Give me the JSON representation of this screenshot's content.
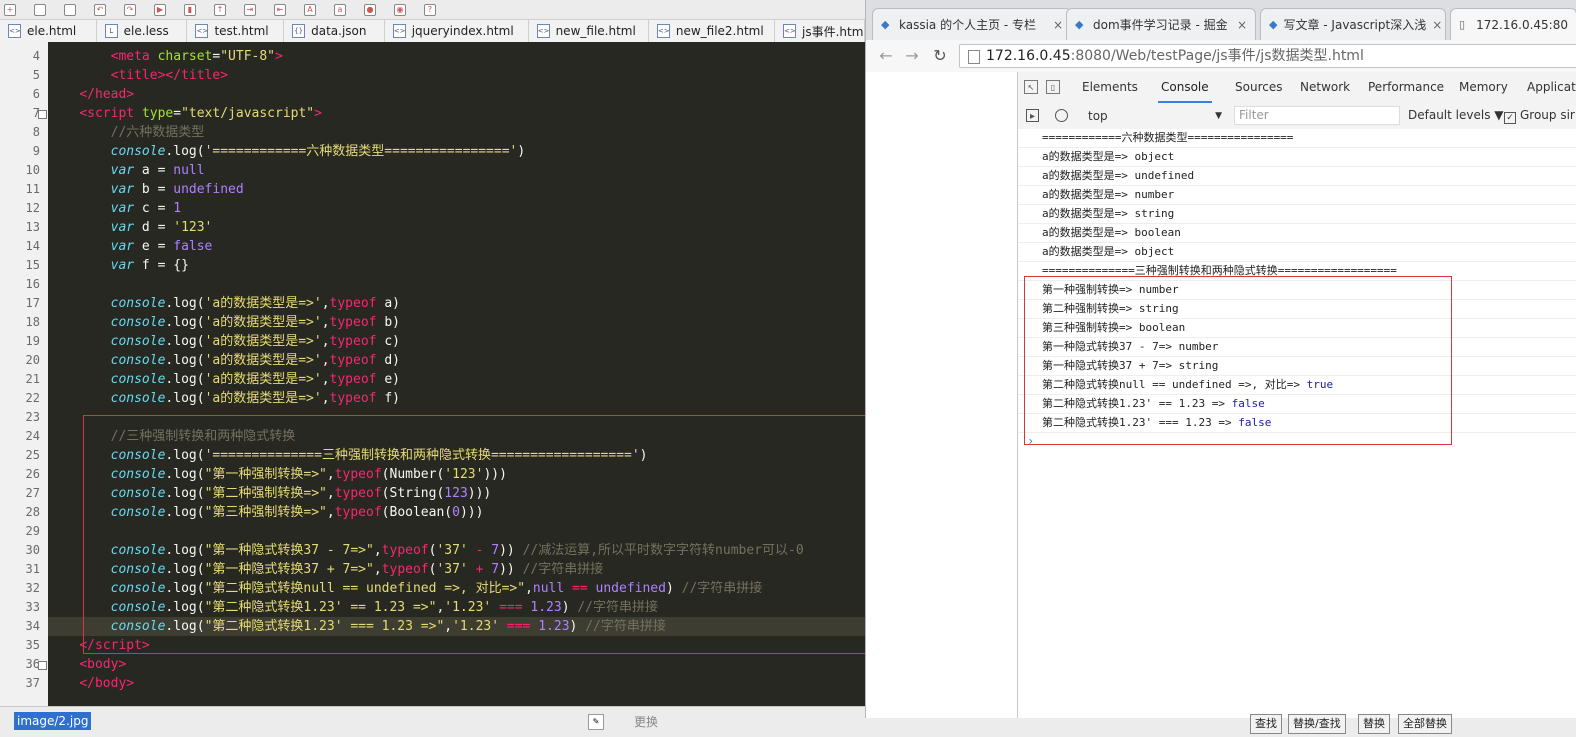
{
  "editor": {
    "tabs": [
      "ele.html",
      "ele.less",
      "test.html",
      "data.json",
      "jqueryindex.html",
      "new_file.html",
      "new_file2.html",
      "js事件.htm"
    ],
    "line_numbers": [
      "4",
      "5",
      "6",
      "7",
      "8",
      "9",
      "10",
      "11",
      "12",
      "13",
      "14",
      "15",
      "16",
      "17",
      "18",
      "19",
      "20",
      "21",
      "22",
      "23",
      "24",
      "25",
      "26",
      "27",
      "28",
      "29",
      "30",
      "31",
      "32",
      "33",
      "34",
      "35",
      "36",
      "37"
    ],
    "status_path": "image/2.jpg",
    "replace_label": "更换"
  },
  "browser": {
    "tabs": [
      "kassia 的个人主页 - 专栏",
      "dom事件学习记录 - 掘金",
      "写文章 - Javascript深入浅",
      "172.16.0.45:80"
    ],
    "url_host": "172.16.0.45",
    "url_rest": ":8080/Web/testPage/js事件/js数据类型.html",
    "devtools_tabs": [
      "Elements",
      "Console",
      "Sources",
      "Network",
      "Performance",
      "Memory",
      "Applicat"
    ],
    "context": "top",
    "filter_placeholder": "Filter",
    "levels": "Default levels ▼",
    "group_similar": "Group sir",
    "console_lines": [
      "============六种数据类型================",
      "a的数据类型是=> object",
      "a的数据类型是=> undefined",
      "a的数据类型是=> number",
      "a的数据类型是=> string",
      "a的数据类型是=> boolean",
      "a的数据类型是=> object",
      "==============三种强制转换和两种隐式转换==================",
      "第一种强制转换=> number",
      "第二种强制转换=> string",
      "第三种强制转换=> boolean",
      "第一种隐式转换37 - 7=> number",
      "第一种隐式转换37 + 7=> string",
      "第二种隐式转换null == undefined =>, 对比=> true",
      "第二种隐式转换1.23' == 1.23 => false",
      "第二种隐式转换1.23' === 1.23 => false"
    ],
    "bottom_buttons": [
      "查找",
      "替换/查找",
      "替换",
      "全部替换"
    ]
  }
}
